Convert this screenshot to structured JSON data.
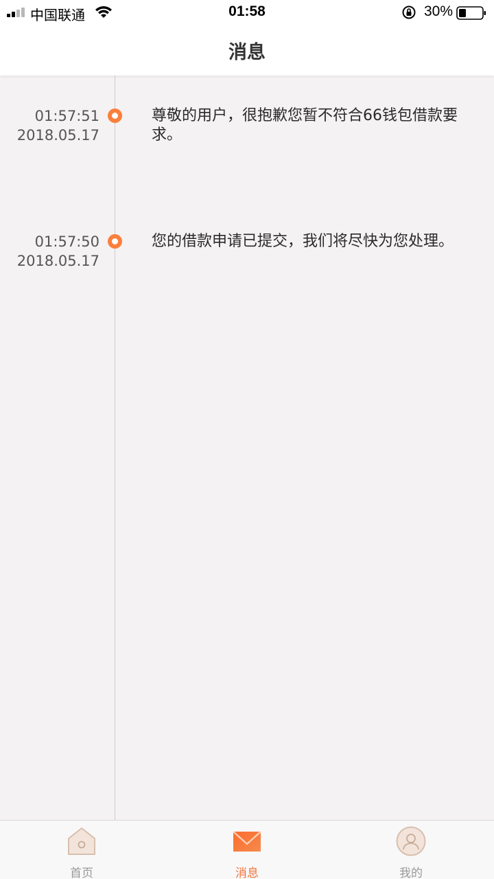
{
  "status_bar": {
    "carrier": "中国联通",
    "time": "01:58",
    "battery": "30%"
  },
  "header": {
    "title": "消息"
  },
  "messages": [
    {
      "time": "01:57:51",
      "date": "2018.05.17",
      "text": "尊敬的用户，很抱歉您暂不符合66钱包借款要求。"
    },
    {
      "time": "01:57:50",
      "date": "2018.05.17",
      "text": "您的借款申请已提交，我们将尽快为您处理。"
    }
  ],
  "tabs": [
    {
      "label": "首页",
      "icon": "home-icon",
      "active": false
    },
    {
      "label": "消息",
      "icon": "mail-icon",
      "active": true
    },
    {
      "label": "我的",
      "icon": "profile-icon",
      "active": false
    }
  ],
  "colors": {
    "accent": "#f4743b",
    "timeline_dot": "#fb7f3b",
    "background": "#f4f2f3"
  }
}
